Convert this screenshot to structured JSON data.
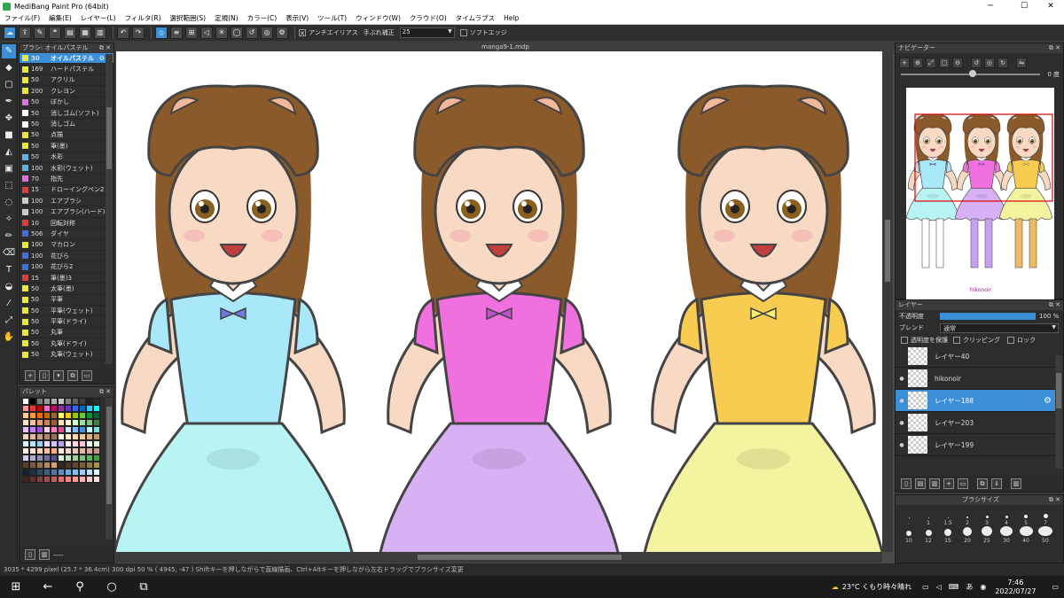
{
  "window": {
    "title": "MediBang Paint Pro (64bit)",
    "min": "─",
    "max": "☐",
    "close": "✕"
  },
  "menu": [
    "ファイル(F)",
    "編集(E)",
    "レイヤー(L)",
    "フィルタ(R)",
    "選択範囲(S)",
    "定規(N)",
    "カラー(C)",
    "表示(V)",
    "ツール(T)",
    "ウィンドウ(W)",
    "クラウド(O)",
    "タイムラプス",
    "Help"
  ],
  "toolbar": {
    "antialias_label": "アンチエイリアス",
    "stabilizer_label": "手ぶれ補正",
    "stabilizer_value": "25",
    "soft_edge_label": "ソフトエッジ"
  },
  "brush_panel": {
    "title": "ブラシ: オイルパステル",
    "items": [
      {
        "size": "30",
        "name": "オイルパステル",
        "color": "#e8e83a",
        "selected": true
      },
      {
        "size": "169",
        "name": "ハードパステル",
        "color": "#e8e83a"
      },
      {
        "size": "50",
        "name": "アクリル",
        "color": "#e8e83a"
      },
      {
        "size": "200",
        "name": "クレヨン",
        "color": "#e8e83a"
      },
      {
        "size": "50",
        "name": "ぼかし",
        "color": "#e070e0"
      },
      {
        "size": "50",
        "name": "消しゴム(ソフト)",
        "color": "#ffffff"
      },
      {
        "size": "50",
        "name": "消しゴム",
        "color": "#ffffff"
      },
      {
        "size": "50",
        "name": "点描",
        "color": "#e8e83a"
      },
      {
        "size": "50",
        "name": "筆(墨)",
        "color": "#e8e83a"
      },
      {
        "size": "50",
        "name": "水彩",
        "color": "#5ab4e8"
      },
      {
        "size": "100",
        "name": "水彩(ウェット)",
        "color": "#5ab4e8"
      },
      {
        "size": "70",
        "name": "指先",
        "color": "#e070e0"
      },
      {
        "size": "15",
        "name": "ドローイングペン2",
        "color": "#e03a3a"
      },
      {
        "size": "100",
        "name": "エアブラシ",
        "color": "#cccccc"
      },
      {
        "size": "100",
        "name": "エアブラシ(ハード)",
        "color": "#cccccc"
      },
      {
        "size": "10",
        "name": "回転対称",
        "color": "#e03a3a"
      },
      {
        "size": "506",
        "name": "ダイヤ",
        "color": "#3a70e0"
      },
      {
        "size": "100",
        "name": "マカロン",
        "color": "#e8e83a"
      },
      {
        "size": "100",
        "name": "花びら",
        "color": "#3a70e0"
      },
      {
        "size": "100",
        "name": "花びら2",
        "color": "#3a70e0"
      },
      {
        "size": "15",
        "name": "筆(墨)3",
        "color": "#e03a3a"
      },
      {
        "size": "50",
        "name": "太筆(墨)",
        "color": "#e8e83a"
      },
      {
        "size": "50",
        "name": "平筆",
        "color": "#e8e83a"
      },
      {
        "size": "50",
        "name": "平筆(ウェット)",
        "color": "#e8e83a"
      },
      {
        "size": "50",
        "name": "平筆(ドライ)",
        "color": "#e8e83a"
      },
      {
        "size": "50",
        "name": "丸筆",
        "color": "#e8e83a"
      },
      {
        "size": "50",
        "name": "丸筆(ドライ)",
        "color": "#e8e83a"
      },
      {
        "size": "50",
        "name": "丸筆(ウェット)",
        "color": "#e8e83a"
      }
    ]
  },
  "palette_panel": {
    "title": "パレット",
    "footer": "----",
    "colors": [
      "#ffffff",
      "#000000",
      "#7a7a7a",
      "#9a9a9a",
      "#b0b0b0",
      "#c8c8c8",
      "#808080",
      "#606060",
      "#404040",
      "#202020",
      "#2a2a2a",
      "#ff9999",
      "#ff3333",
      "#cc0000",
      "#ff66cc",
      "#cc0066",
      "#993399",
      "#6633cc",
      "#3366ff",
      "#0066cc",
      "#33ccff",
      "#00ffff",
      "#ffcc99",
      "#ff9933",
      "#ff6600",
      "#cc6600",
      "#996633",
      "#ffff66",
      "#ffcc00",
      "#99cc00",
      "#66cc33",
      "#009933",
      "#006633",
      "#ffe0cc",
      "#f5c09a",
      "#e8a070",
      "#d08050",
      "#a05a30",
      "#ffe8b0",
      "#fff0d0",
      "#d0ffd0",
      "#a0e0a0",
      "#80c080",
      "#408040",
      "#e8c0ff",
      "#c080ff",
      "#a050e0",
      "#ffd0e8",
      "#ff80c0",
      "#e05090",
      "#d0e8ff",
      "#80c0ff",
      "#4090e0",
      "#c0ffff",
      "#80e0e0",
      "#f0d0c0",
      "#e0b8a0",
      "#c8a088",
      "#b08870",
      "#987058",
      "#fff8e0",
      "#ffe8c8",
      "#f8d8b0",
      "#f0c898",
      "#e0b080",
      "#c89868",
      "#d8f0ff",
      "#b8e0f8",
      "#98d0f0",
      "#e8e0ff",
      "#d0c0f8",
      "#b8a0f0",
      "#fff0f8",
      "#ffd8e8",
      "#ffc0d8",
      "#f0fff0",
      "#d8f8d8",
      "#fff0e8",
      "#ffe0d0",
      "#ffd0b8",
      "#ffc0a0",
      "#ffb088",
      "#f8e8e0",
      "#f0d8d0",
      "#e8c8c0",
      "#e0b8b0",
      "#d8a8a0",
      "#c89890",
      "#d0d0e8",
      "#b0b0d0",
      "#9090b8",
      "#7070a0",
      "#505088",
      "#e0f0e0",
      "#c0e0c0",
      "#a0d0a0",
      "#80c080",
      "#60b060",
      "#40a040",
      "#584030",
      "#785840",
      "#987050",
      "#b88860",
      "#d8a070",
      "#302820",
      "#483828",
      "#604830",
      "#786038",
      "#907840",
      "#a89048",
      "#102030",
      "#203040",
      "#304860",
      "#406080",
      "#5078a0",
      "#6090c0",
      "#70a8e0",
      "#80c0ff",
      "#a0d0ff",
      "#c0e0ff",
      "#e0f0ff",
      "#402020",
      "#603030",
      "#804040",
      "#a05050",
      "#c06060",
      "#e07070",
      "#ff8080",
      "#ff9898",
      "#ffb0b0",
      "#ffc8c8",
      "#ffe0e0"
    ]
  },
  "document": {
    "tab": "manga9-1.mdp"
  },
  "navigator": {
    "title": "ナビゲーター",
    "angle": "0 度",
    "signature": "hikonoir"
  },
  "layer_panel": {
    "title": "レイヤー",
    "opacity_label": "不透明度",
    "opacity_value": "100 %",
    "blend_label": "ブレンド",
    "blend_value": "通常",
    "protect_label": "透明度を保護",
    "clipping_label": "クリッピング",
    "lock_label": "ロック",
    "layers": [
      {
        "name": "レイヤー40",
        "selected": false
      },
      {
        "name": "hikonoir",
        "selected": false
      },
      {
        "name": "レイヤー188",
        "selected": true
      },
      {
        "name": "レイヤー203",
        "selected": false
      },
      {
        "name": "レイヤー199",
        "selected": false
      }
    ]
  },
  "brush_size_panel": {
    "title": "ブラシサイズ",
    "sizes": [
      ".",
      "1",
      "1.5",
      "2",
      "3",
      "4",
      "5",
      "7",
      "10",
      "12",
      "15",
      "20",
      "25",
      "30",
      "40",
      "50"
    ]
  },
  "status_bar": {
    "text": "3035 * 4299 pixel  (25.7 * 36.4cm)  300 dpi  50 %  ( 4945, -47 )  Shiftキーを押しながらで直線描画、Ctrl+Altキーを押しながら左右ドラッグでブラシサイズ変更"
  },
  "taskbar": {
    "weather": "23°C くもり時々晴れ",
    "time": "7:46",
    "date": "2022/07/27"
  },
  "colors": {
    "accent": "#3a8fd6",
    "panel_bg": "#2d2d2d"
  }
}
